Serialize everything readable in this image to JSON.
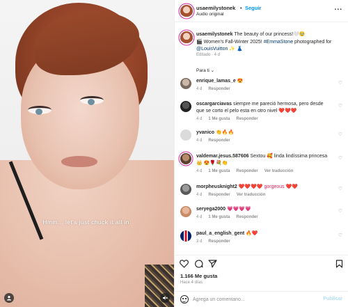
{
  "video": {
    "subtitle": "Hmm... let's just chuck it all in."
  },
  "header": {
    "username": "usaemilystonek",
    "separator": "•",
    "follow_label": "Seguir",
    "audio_label": "Audio original",
    "more_label": "..."
  },
  "caption": {
    "username": "usaemilystonek",
    "text_1": " The beauty of our princess!🤍🥹",
    "text_2": "🎬 Women's Fall-Winter 2025! ",
    "hashtag": "#EmmaStone",
    "text_3": " photographed for ",
    "mention": "@LouisVuitton",
    "text_4": " ✨ 👗",
    "meta": "Editado · 4 d"
  },
  "filter_label": "Para ti ⌄",
  "comments": [
    {
      "user": "enrique_lamas_e",
      "text": "😍",
      "time": "4 d",
      "likes": "",
      "reply": "Responder",
      "extra": ""
    },
    {
      "user": "oscargarciavas",
      "text": "siempre me pareció hermosa, pero desde que se corto el pelo esta en otro nivel ❤️❤️❤️",
      "time": "4 d",
      "likes": "1 Me gusta",
      "reply": "Responder",
      "extra": ""
    },
    {
      "user": "yvanico",
      "text": "👏🔥🔥",
      "time": "4 d",
      "likes": "",
      "reply": "Responder",
      "extra": ""
    },
    {
      "user": "valdemar.jesus.587606",
      "text": "Sextou 🥰 linda lindíssima princesa 👑 😍🌹💐👏",
      "time": "4 d",
      "likes": "1 Me gusta",
      "reply": "Responder",
      "extra": "Ver traducción"
    },
    {
      "user": "morpheusknight2",
      "text": "❤️❤️❤️❤️ gorgeous ❤️❤️",
      "time": "4 d",
      "likes": "",
      "reply": "Responder",
      "extra": "Ver traducción"
    },
    {
      "user": "seryega2000",
      "text": "💗💗💗💗",
      "time": "4 d",
      "likes": "1 Me gusta",
      "reply": "Responder",
      "extra": ""
    },
    {
      "user": "paul_a_english_gent",
      "text": "🔥❤️",
      "time": "3 d",
      "likes": "",
      "reply": "Responder",
      "extra": ""
    }
  ],
  "likes_text": "1.166 Me gusta",
  "time_ago": "Hace 4 días",
  "composer": {
    "placeholder": "Agrega un comentario...",
    "post_label": "Publicar"
  },
  "icons": {
    "like": "heart-icon",
    "comment": "comment-icon",
    "share": "share-icon",
    "save": "bookmark-icon",
    "emoji": "emoji-icon",
    "comment_like": "heart-icon",
    "user_tag": "user-icon",
    "mute": "mute-icon"
  },
  "colors": {
    "accent": "#0095f6",
    "story_ring": "#d6249f",
    "muted": "#8e8e8e",
    "post_disabled": "#b2dffc"
  }
}
